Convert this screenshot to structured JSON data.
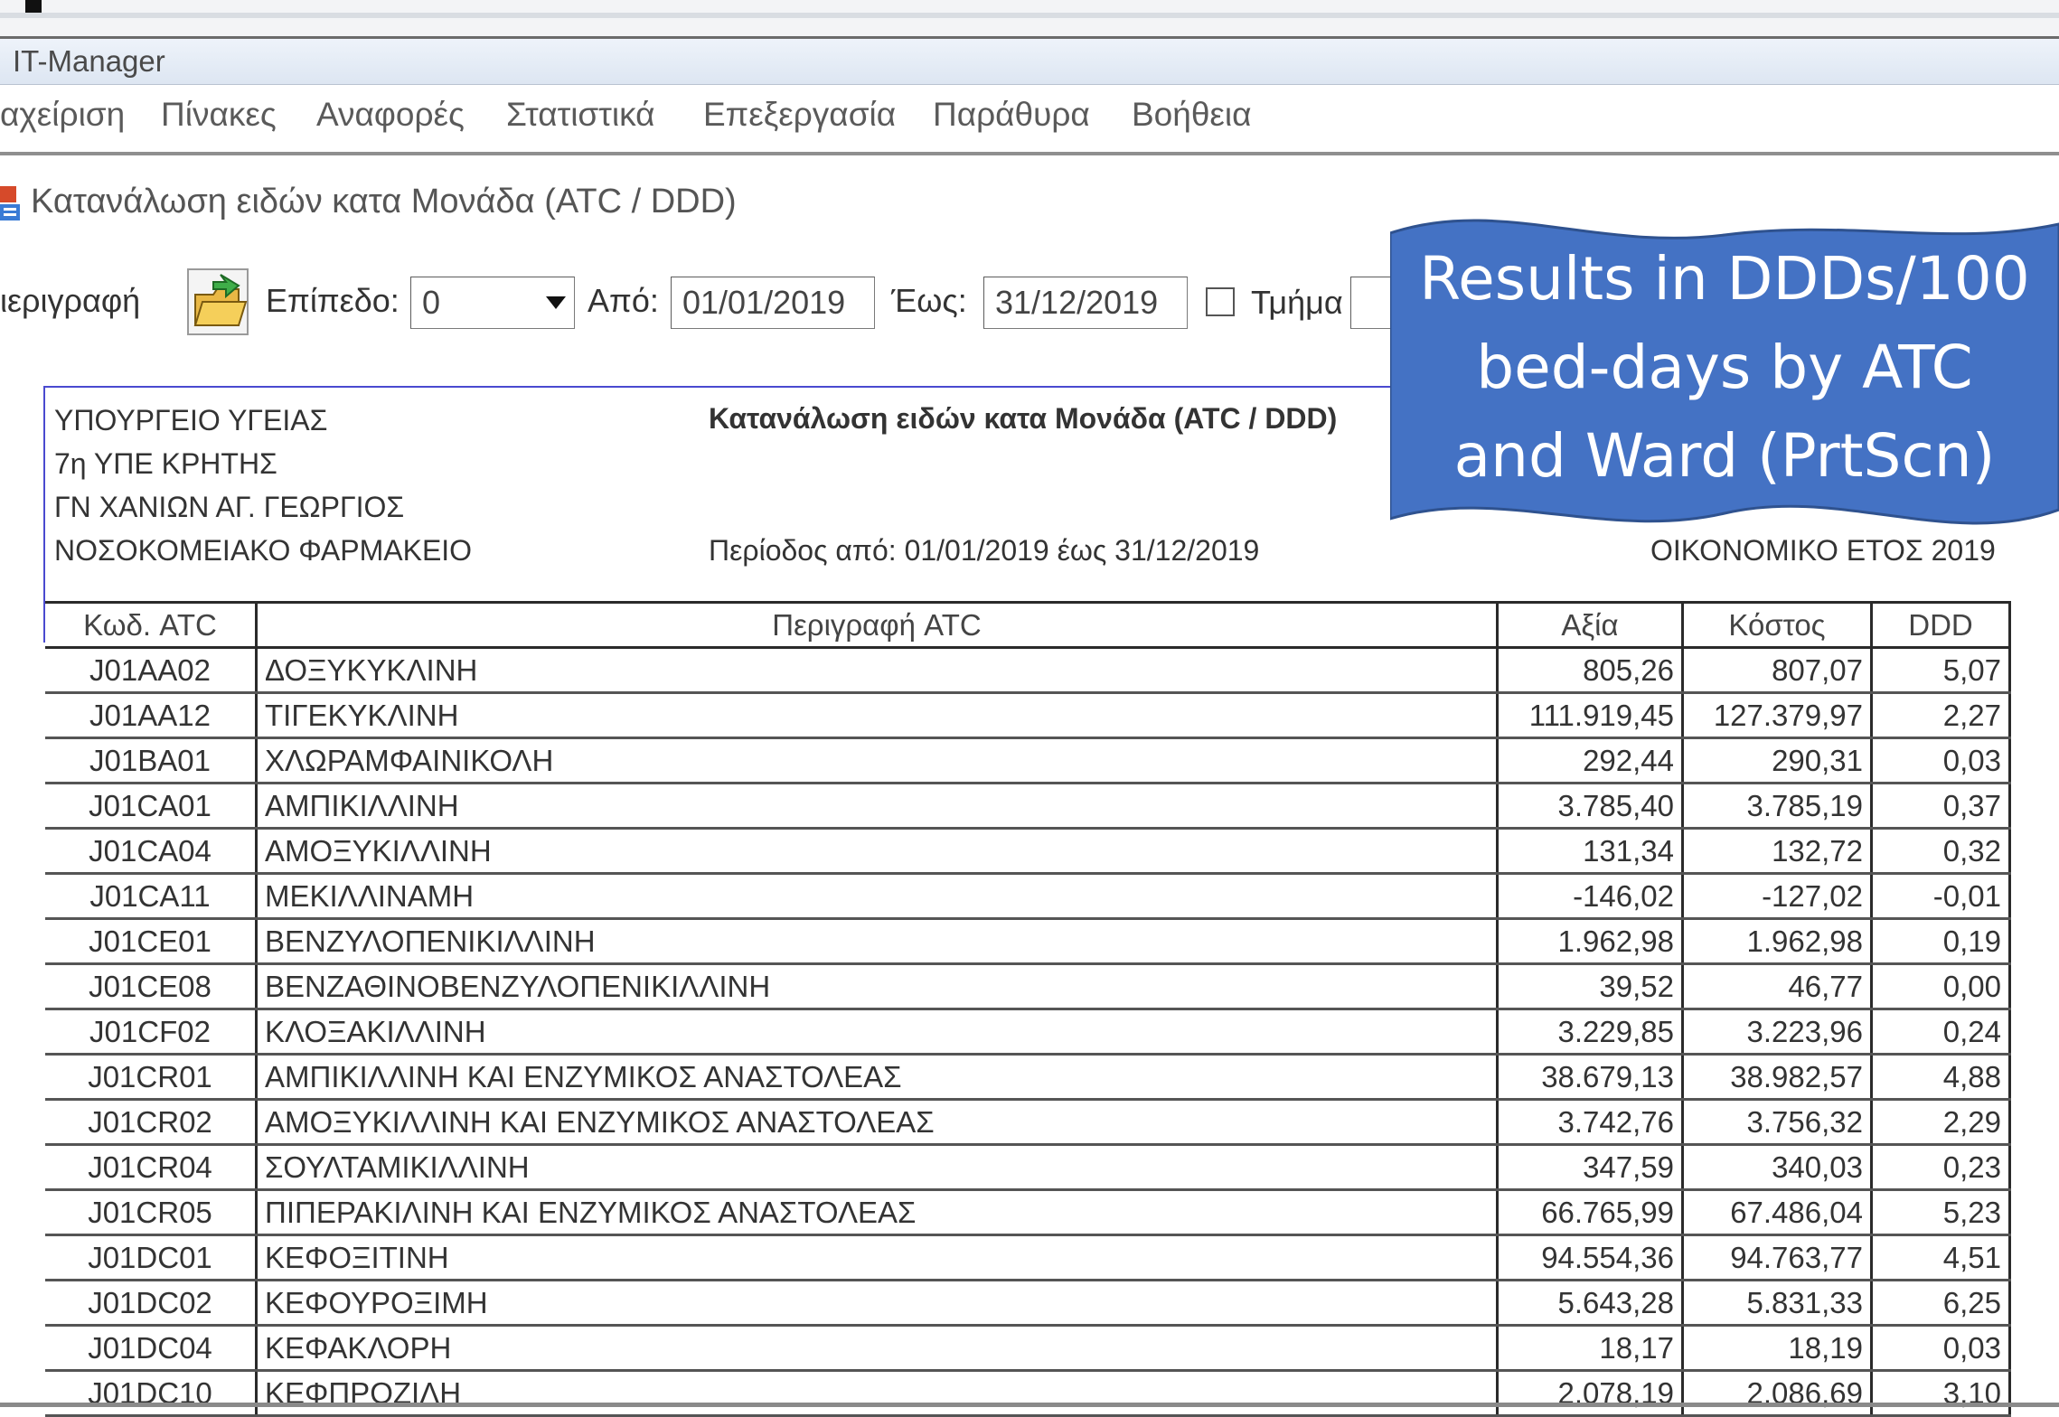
{
  "window": {
    "title": "IT-Manager"
  },
  "menu": [
    "αχείριση",
    "Πίνακες",
    "Αναφορές",
    "Στατιστικά",
    "Επεξεργασία",
    "Παράθυρα",
    "Βοήθεια"
  ],
  "child_window": {
    "title": "Κατανάλωση ειδών κατα Μονάδα (ATC / DDD)"
  },
  "toolbar": {
    "description_label": "ιεριγραφή",
    "level_label": "Επίπεδο:",
    "level_value": "0",
    "from_label": "Από:",
    "from_value": "01/01/2019",
    "to_label": "Έως:",
    "to_value": "31/12/2019",
    "department_label": "Τμήμα"
  },
  "report_header": {
    "org_line1": "ΥΠΟΥΡΓΕΙΟ ΥΓΕΙΑΣ",
    "org_line2": "7η ΥΠΕ ΚΡΗΤΗΣ",
    "org_line3": "ΓΝ ΧΑΝΙΩΝ ΑΓ. ΓΕΩΡΓΙΟΣ",
    "org_line4": "ΝΟΣΟΚΟΜΕΙΑΚΟ ΦΑΡΜΑΚΕΙΟ",
    "title": "Κατανάλωση ειδών κατα Μονάδα (ATC / DDD)",
    "period": "Περίοδος από: 01/01/2019 έως 31/12/2019",
    "fiscal_year": "ΟΙΚΟΝΟΜΙΚΟ ΕΤΟΣ 2019"
  },
  "table": {
    "columns": [
      "Κωδ. ATC",
      "Περιγραφή ATC",
      "Αξία",
      "Κόστος",
      "DDD"
    ],
    "rows": [
      [
        "J01AA02",
        "ΔΟΞΥΚΥΚΛΙΝΗ",
        "805,26",
        "807,07",
        "5,07"
      ],
      [
        "J01AA12",
        "ΤΙΓΕΚΥΚΛΙΝΗ",
        "111.919,45",
        "127.379,97",
        "2,27"
      ],
      [
        "J01BA01",
        "ΧΛΩΡΑΜΦΑΙΝΙΚΟΛΗ",
        "292,44",
        "290,31",
        "0,03"
      ],
      [
        "J01CA01",
        "ΑΜΠΙΚΙΛΛΙΝΗ",
        "3.785,40",
        "3.785,19",
        "0,37"
      ],
      [
        "J01CA04",
        "ΑΜΟΞΥΚΙΛΛΙΝΗ",
        "131,34",
        "132,72",
        "0,32"
      ],
      [
        "J01CA11",
        "ΜΕΚΙΛΛΙΝΑΜΗ",
        "-146,02",
        "-127,02",
        "-0,01"
      ],
      [
        "J01CE01",
        "ΒΕΝΖΥΛΟΠΕΝΙΚΙΛΛΙΝΗ",
        "1.962,98",
        "1.962,98",
        "0,19"
      ],
      [
        "J01CE08",
        "ΒΕΝΖΑΘΙΝΟΒΕΝΖΥΛΟΠΕΝΙΚΙΛΛΙΝΗ",
        "39,52",
        "46,77",
        "0,00"
      ],
      [
        "J01CF02",
        "ΚΛΟΞΑΚΙΛΛΙΝΗ",
        "3.229,85",
        "3.223,96",
        "0,24"
      ],
      [
        "J01CR01",
        "ΑΜΠΙΚΙΛΛΙΝΗ ΚΑΙ ΕΝΖΥΜΙΚΟΣ ΑΝΑΣΤΟΛΕΑΣ",
        "38.679,13",
        "38.982,57",
        "4,88"
      ],
      [
        "J01CR02",
        "ΑΜΟΞΥΚΙΛΛΙΝΗ ΚΑΙ ΕΝΖΥΜΙΚΟΣ ΑΝΑΣΤΟΛΕΑΣ",
        "3.742,76",
        "3.756,32",
        "2,29"
      ],
      [
        "J01CR04",
        "ΣΟΥΛΤΑΜΙΚΙΛΛΙΝΗ",
        "347,59",
        "340,03",
        "0,23"
      ],
      [
        "J01CR05",
        "ΠΙΠΕΡΑΚΙΛΙΝΗ ΚΑΙ ΕΝΖΥΜΙΚΟΣ ΑΝΑΣΤΟΛΕΑΣ",
        "66.765,99",
        "67.486,04",
        "5,23"
      ],
      [
        "J01DC01",
        "ΚΕΦΟΞΙΤΙΝΗ",
        "94.554,36",
        "94.763,77",
        "4,51"
      ],
      [
        "J01DC02",
        "ΚΕΦΟΥΡΟΞΙΜΗ",
        "5.643,28",
        "5.831,33",
        "6,25"
      ],
      [
        "J01DC04",
        "ΚΕΦΑΚΛΟΡΗ",
        "18,17",
        "18,19",
        "0,03"
      ],
      [
        "J01DC10",
        "ΚΕΦΠΡΟΖΙΛΗ",
        "2.078,19",
        "2.086,69",
        "3,10"
      ]
    ]
  },
  "callout": {
    "line1": "Results in DDDs/100",
    "line2": "bed-days by ATC",
    "line3": "and Ward (PrtScn)",
    "color": "#4472c4"
  }
}
